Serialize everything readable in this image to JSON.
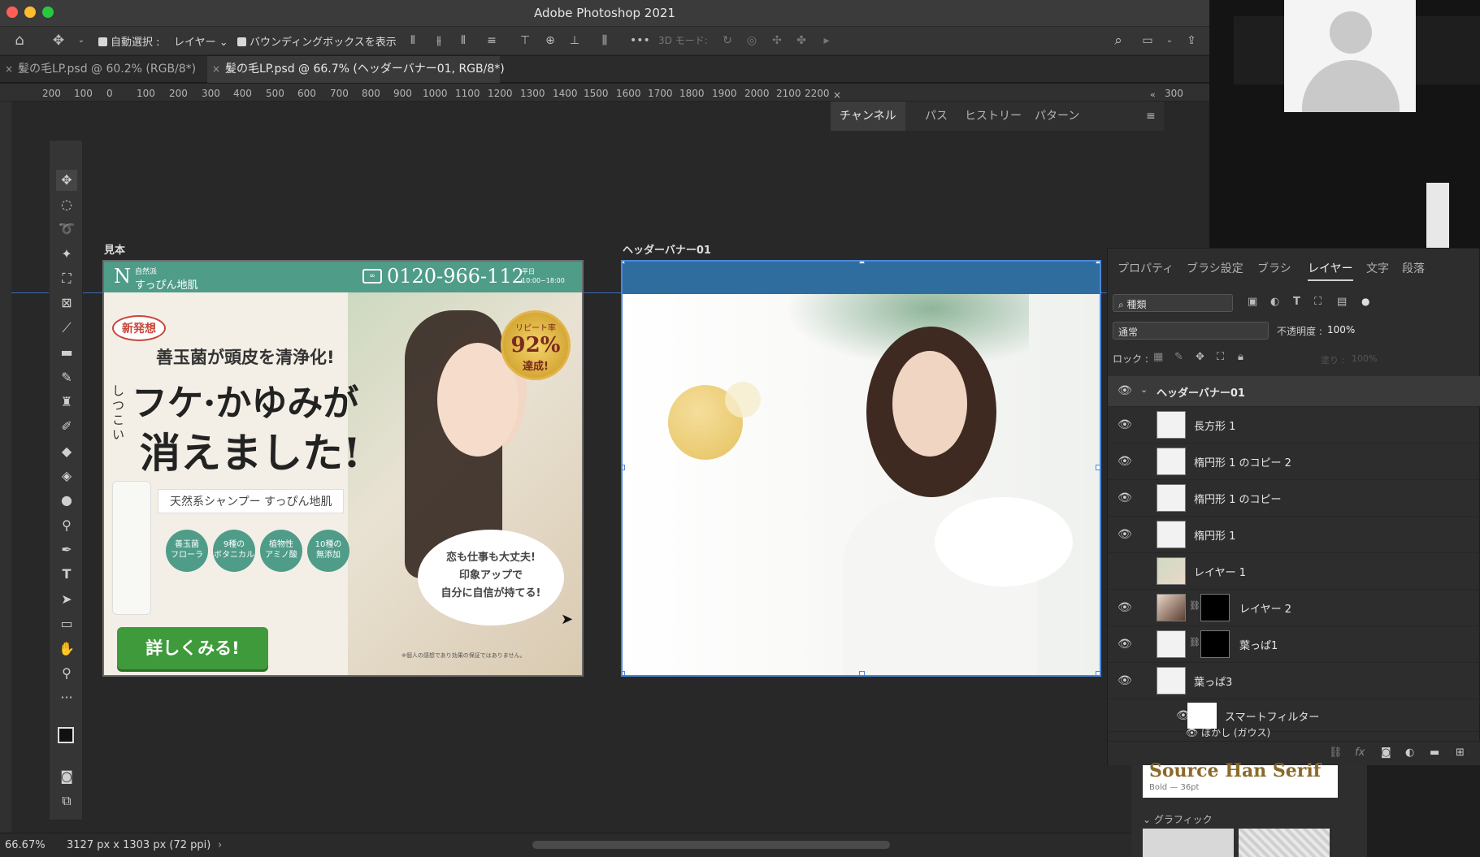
{
  "window": {
    "title": "Adobe Photoshop 2021"
  },
  "options_bar": {
    "auto_select_label": "自動選択 :",
    "auto_select_value": "レイヤー",
    "bounding_box_label": "バウンディングボックスを表示",
    "mode_3d_label": "3D モード:"
  },
  "tabs": [
    {
      "label": "髪の毛LP.psd @ 60.2% (RGB/8*)"
    },
    {
      "label": "髪の毛LP.psd @ 66.7% (ヘッダーバナー01, RGB/8*)"
    }
  ],
  "ruler": {
    "labels": [
      "200",
      "100",
      "0",
      "100",
      "200",
      "300",
      "400",
      "500",
      "600",
      "700",
      "800",
      "900",
      "1000",
      "1100",
      "1200",
      "1300",
      "1400",
      "1500",
      "1600",
      "1700",
      "1800",
      "1900",
      "2000",
      "2100",
      "2200",
      "300"
    ]
  },
  "panel_group_top": {
    "tabs": [
      "チャンネル",
      "パス",
      "ヒストリー",
      "パターン"
    ]
  },
  "artboards": {
    "sample": {
      "label": "見本",
      "brand_small": "自然派",
      "brand": "すっぴん地肌",
      "phone": "0120-966-112",
      "hours_1": "平日",
      "hours_2": "10:00~18:00",
      "badge_new": "新発想",
      "headline_1": "善玉菌が頭皮を清浄化!",
      "headline_prefix": "しつこい",
      "headline_2": "フケ·かゆみが",
      "headline_3": "消えました!",
      "repeat_label": "リピート率",
      "repeat_value": "92%",
      "repeat_done": "達成!",
      "product_line": "天然系シャンプー すっぴん地肌",
      "features": [
        "善玉菌\nフローラ",
        "9種の\nボタニカル",
        "植物性\nアミノ酸",
        "10種の\n無添加"
      ],
      "bubble_1": "恋も仕事も大丈夫!",
      "bubble_2": "印象アップで",
      "bubble_3": "自分に自信が持てる!",
      "cta": "詳しくみる!",
      "disclaimer": "※個人の感想であり効果の保証ではありません。"
    },
    "banner": {
      "label": "ヘッダーバナー01"
    }
  },
  "layers_panel": {
    "tabs": [
      "プロパティ",
      "ブラシ設定",
      "ブラシ",
      "レイヤー",
      "文字",
      "段落"
    ],
    "active_tab": "レイヤー",
    "filter_kind": "種類",
    "blend_mode": "通常",
    "opacity_label": "不透明度 :",
    "opacity_value": "100%",
    "lock_label": "ロック :",
    "fill_label": "塗り :",
    "fill_value": "100%",
    "group_name": "ヘッダーバナー01",
    "layers": [
      {
        "name": "長方形 1",
        "visible": true
      },
      {
        "name": "楕円形 1 のコピー 2",
        "visible": true
      },
      {
        "name": "楕円形 1 のコピー",
        "visible": true
      },
      {
        "name": "楕円形 1",
        "visible": true
      },
      {
        "name": "レイヤー 1",
        "visible": false
      },
      {
        "name": "レイヤー 2",
        "visible": true
      },
      {
        "name": "葉っぱ1",
        "visible": true
      },
      {
        "name": "葉っぱ3",
        "visible": true
      }
    ],
    "smart_filter": "スマートフィルター",
    "blur_filter": "ぼかし (ガウス)"
  },
  "status": {
    "zoom": "66.67%",
    "doc_info": "3127 px x 1303 px (72 ppi)"
  },
  "library": {
    "font_name": "Source Han Serif",
    "font_style": "Bold — 36pt",
    "section": "グラフィック"
  },
  "colors": {
    "teal": "#4f9c89",
    "banner_blue": "#2f6d9e",
    "cta_green": "#3f9a3c",
    "selection_blue": "#4c86d9"
  }
}
